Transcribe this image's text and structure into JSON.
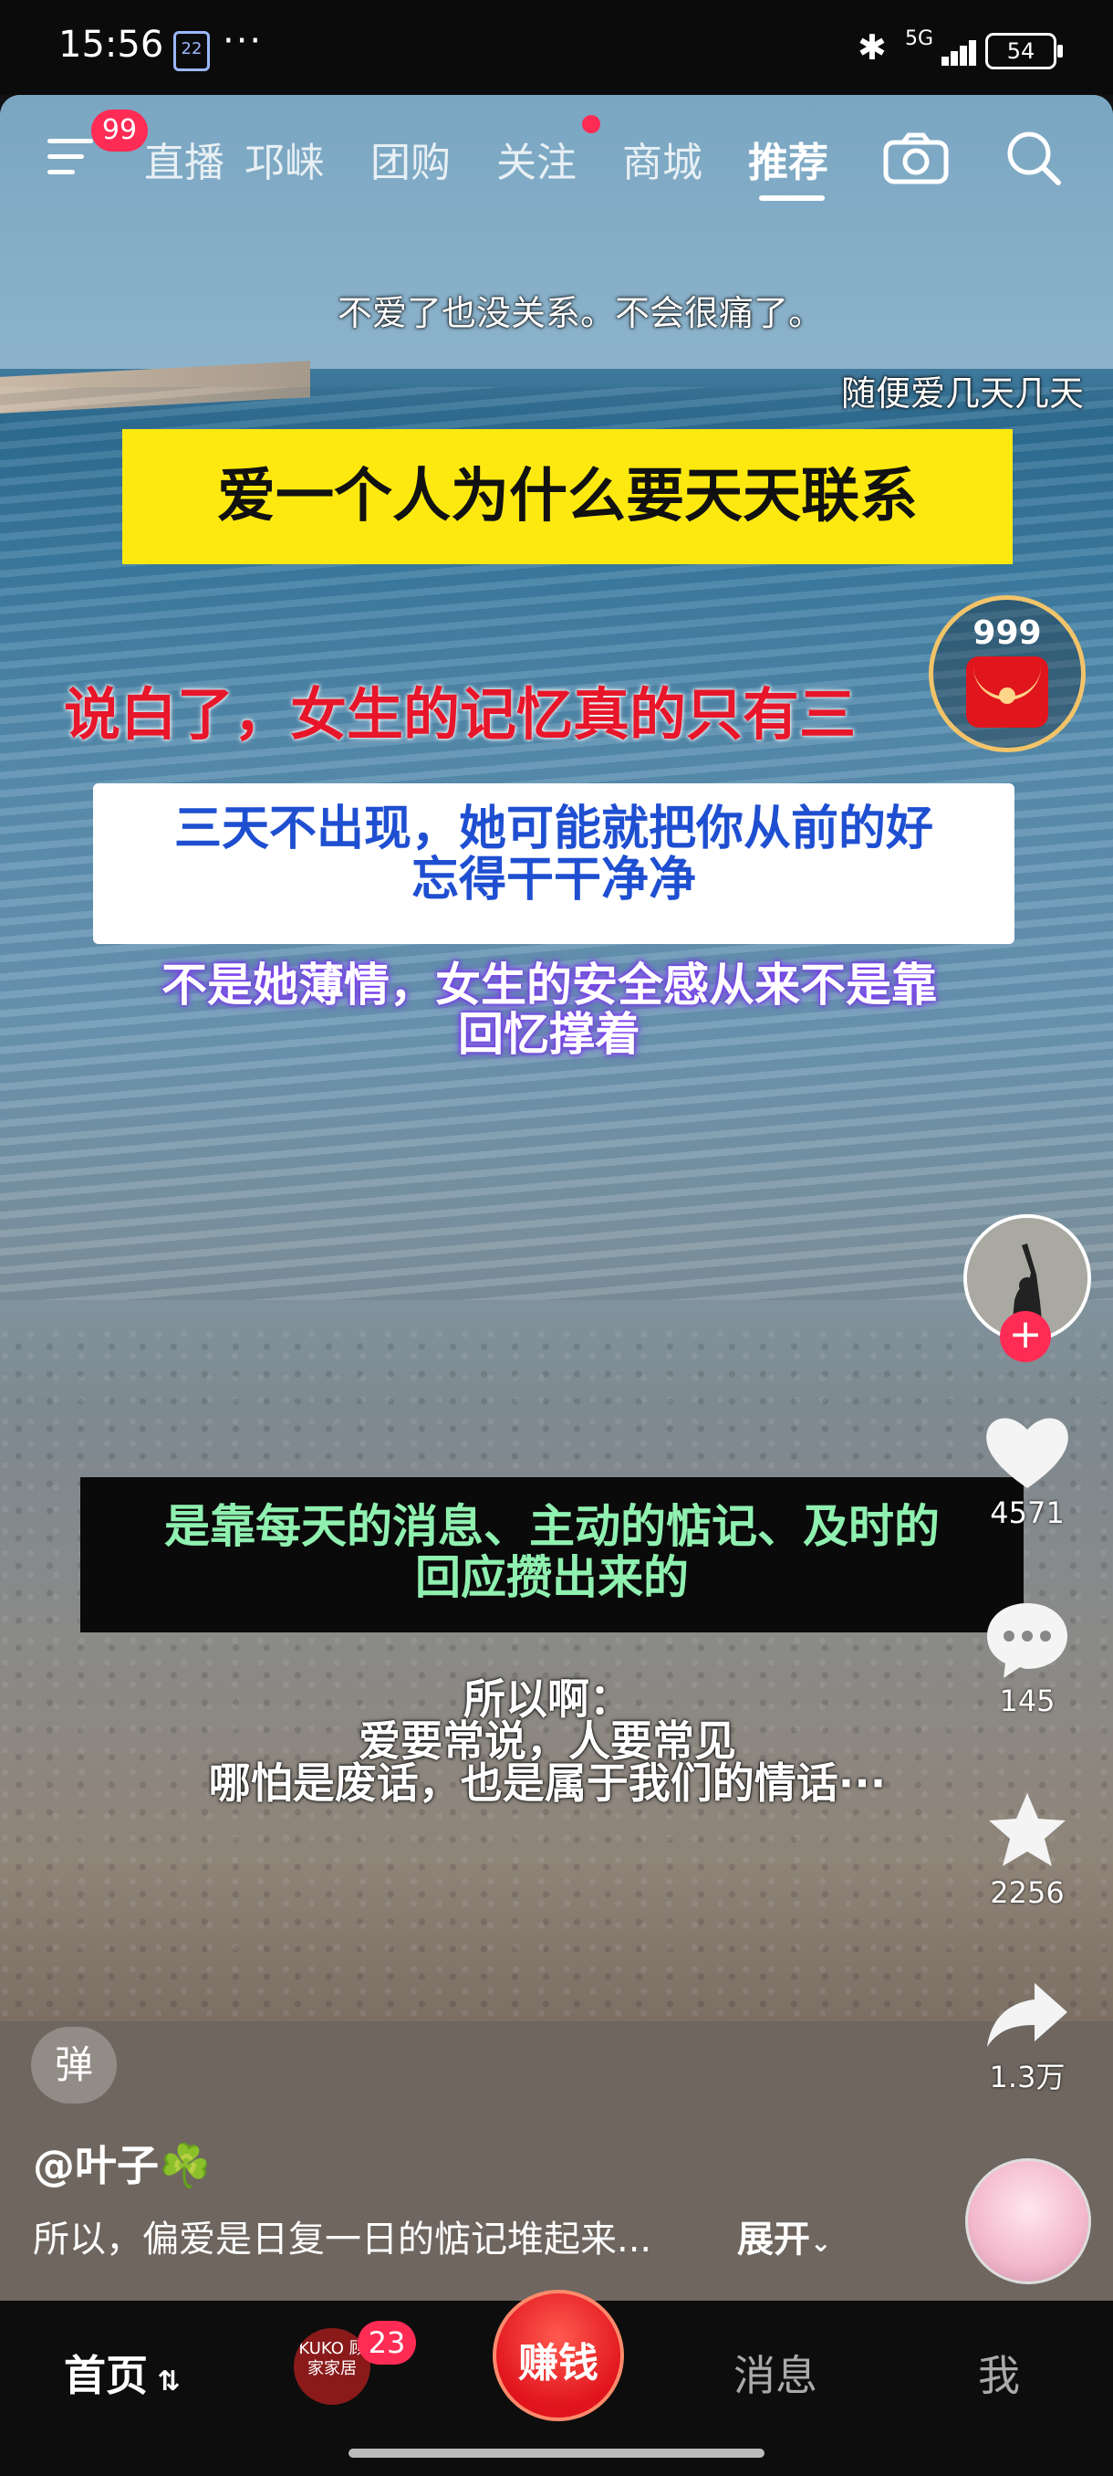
{
  "status_bar": {
    "time": "15:56",
    "calendar": "22",
    "more": "···",
    "network": "5G",
    "battery": "54"
  },
  "top_nav": {
    "menu_badge": "99",
    "tabs": [
      "直播",
      "邛崃",
      "团购",
      "关注",
      "商城",
      "推荐"
    ],
    "active_tab": "推荐",
    "icons": [
      "menu-icon",
      "camera-icon",
      "search-icon"
    ]
  },
  "video": {
    "subtitle_1": "不爱了也没关系。不会很痛了。",
    "subtitle_2": "随便爱几天几天",
    "banner": "爱一个人为什么要天天联系",
    "red_line": "说白了，女生的记忆真的只有三",
    "blue_line_1": "三天不出现，她可能就把你从前的好",
    "blue_line_2": "忘得干干净净",
    "purple_line_1": "不是她薄情，女生的安全感从来不是靠",
    "purple_line_2": "回忆撑着",
    "green_line_1": "是靠每天的消息、主动的惦记、及时的",
    "green_line_2": "回应攒出来的",
    "white_line_1": "所以啊：",
    "white_line_2": "爱要常说，人要常见",
    "white_line_3": "哪怕是废话，也是属于我们的情话···"
  },
  "red_packet": {
    "count": "999"
  },
  "side_rail": {
    "likes": "4571",
    "comments": "145",
    "favorites": "2256",
    "shares": "1.3万"
  },
  "post": {
    "danmu": "弹",
    "author": "@叶子☘️",
    "description": "所以，偏爱是日复一日的惦记堆起来...",
    "expand": "展开"
  },
  "bottom_nav": {
    "home": "首页",
    "thumb_text": "KUKO 顾家家居",
    "thumb_badge": "23",
    "earn": "赚钱",
    "messages": "消息",
    "me": "我"
  },
  "colors": {
    "accent_red": "#fe2c55",
    "banner_yellow": "#fde910",
    "caption_red": "#e8162a",
    "caption_blue": "#1f4fd1",
    "caption_green": "#8ff0b0"
  }
}
